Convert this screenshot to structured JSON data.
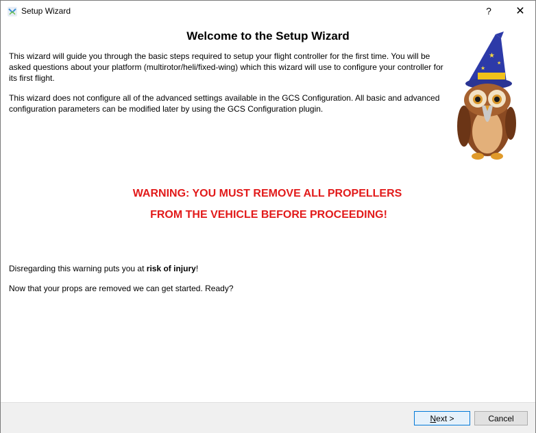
{
  "window": {
    "title": "Setup Wizard",
    "help_label": "?",
    "close_label": "✕"
  },
  "page": {
    "heading": "Welcome to the Setup Wizard",
    "intro": "This wizard will guide you through the basic steps required to setup your flight controller for the first time. You will be asked questions about your platform (multirotor/heli/fixed-wing) which this wizard will use to configure your controller for its first flight.",
    "advanced_note": "This wizard does not configure all of the advanced settings available in the GCS Configuration. All basic and advanced configuration parameters can be modified later by using the GCS Configuration plugin.",
    "warning_line1": "WARNING: YOU MUST REMOVE ALL PROPELLERS",
    "warning_line2": "FROM THE VEHICLE BEFORE PROCEEDING!",
    "risk_prefix": "Disregarding this warning puts you at ",
    "risk_bold": "risk of injury",
    "risk_suffix": "!",
    "ready": "Now that your props are removed we can get started. Ready?"
  },
  "footer": {
    "next_first": "N",
    "next_rest": "ext >",
    "cancel_label": "Cancel"
  },
  "colors": {
    "warning": "#e21a1a",
    "accent": "#0078d7"
  },
  "icons": [
    "app-icon",
    "help-icon",
    "close-icon",
    "wizard-owl-illustration"
  ]
}
